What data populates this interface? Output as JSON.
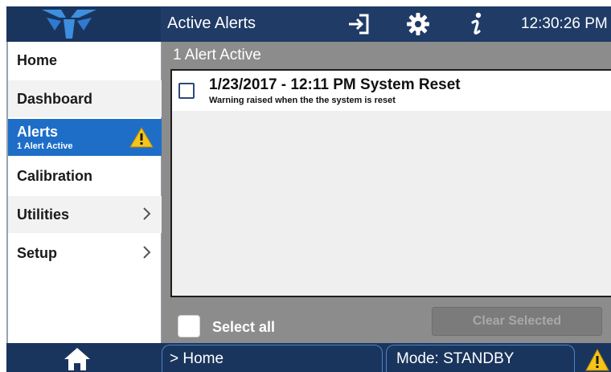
{
  "header": {
    "title": "Active Alerts",
    "clock": "12:30:26 PM",
    "icons": [
      "logo-icon",
      "sign-in-icon",
      "gear-icon",
      "info-icon"
    ]
  },
  "sidebar": {
    "items": [
      {
        "label": "Home"
      },
      {
        "label": "Dashboard"
      },
      {
        "label": "Alerts",
        "sub": "1 Alert Active",
        "active": true,
        "icon": "warning-icon"
      },
      {
        "label": "Calibration"
      },
      {
        "label": "Utilities",
        "icon": "chevron-right-icon"
      },
      {
        "label": "Setup",
        "icon": "chevron-right-icon"
      }
    ]
  },
  "main": {
    "header": "1 Alert Active",
    "alerts": [
      {
        "title": "1/23/2017 - 12:11 PM System Reset",
        "description": "Warning raised when the the system is reset",
        "checked": false
      }
    ],
    "select_all_label": "Select all",
    "clear_label": "Clear Selected"
  },
  "footer": {
    "breadcrumb": "> Home",
    "mode": "Mode: STANDBY",
    "icons": [
      "home-icon",
      "warning-icon"
    ]
  },
  "colors": {
    "topbar": "#1f3b66",
    "accent": "#1e6ec8",
    "warning": "#f5c518",
    "panel": "#8c8c8c"
  }
}
